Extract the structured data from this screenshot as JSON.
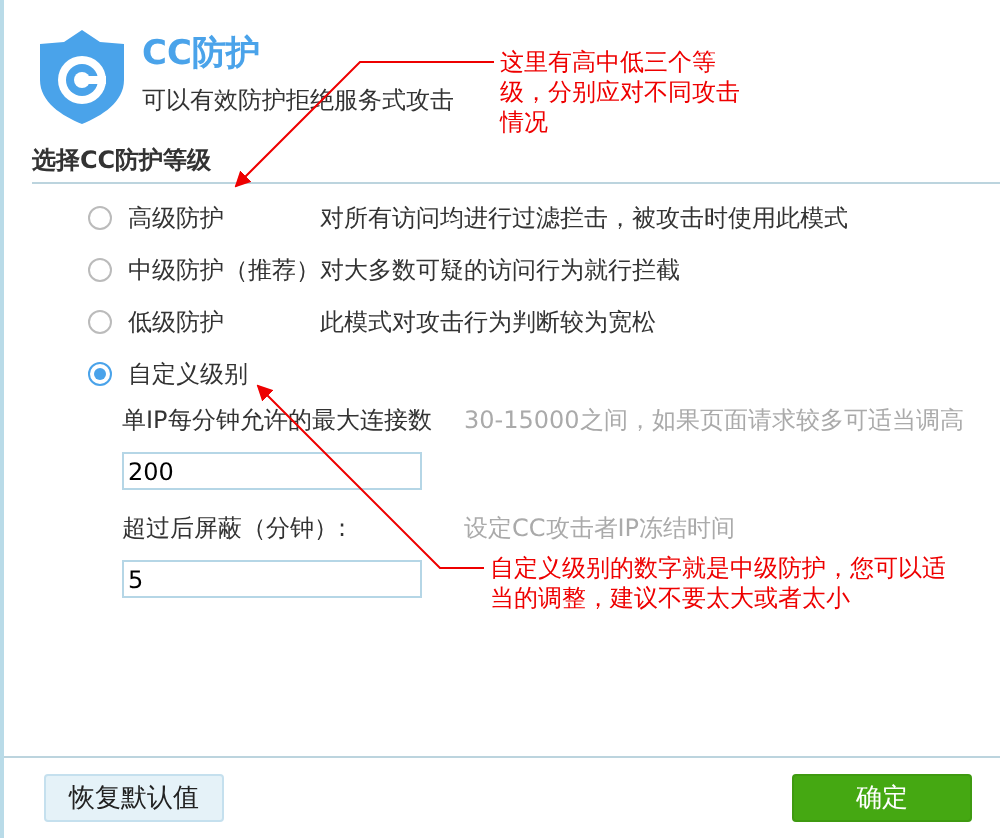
{
  "header": {
    "title": "CC防护",
    "subtitle": "可以有效防护拒绝服务式攻击"
  },
  "section_title": "选择CC防护等级",
  "levels": [
    {
      "label": "高级防护",
      "description": "对所有访问均进行过滤拦击，被攻击时使用此模式",
      "selected": false
    },
    {
      "label": "中级防护（推荐）",
      "description": "对大多数可疑的访问行为就行拦截",
      "selected": false
    },
    {
      "label": "低级防护",
      "description": "此模式对攻击行为判断较为宽松",
      "selected": false
    },
    {
      "label": "自定义级别",
      "selected": true
    }
  ],
  "fields": [
    {
      "label": "单IP每分钟允许的最大连接数",
      "hint": "30-15000之间，如果页面请求较多可适当调高",
      "value": "200"
    },
    {
      "label": "超过后屏蔽（分钟）:",
      "hint": "设定CC攻击者IP冻结时间",
      "value": "5"
    }
  ],
  "annotations": [
    {
      "text": "这里有高中低三个等级，分别应对不同攻击情况"
    },
    {
      "text": "自定义级别的数字就是中级防护，您可以适当的调整，建议不要太大或者太小"
    }
  ],
  "buttons": {
    "reset": "恢复默认值",
    "confirm": "确定"
  }
}
